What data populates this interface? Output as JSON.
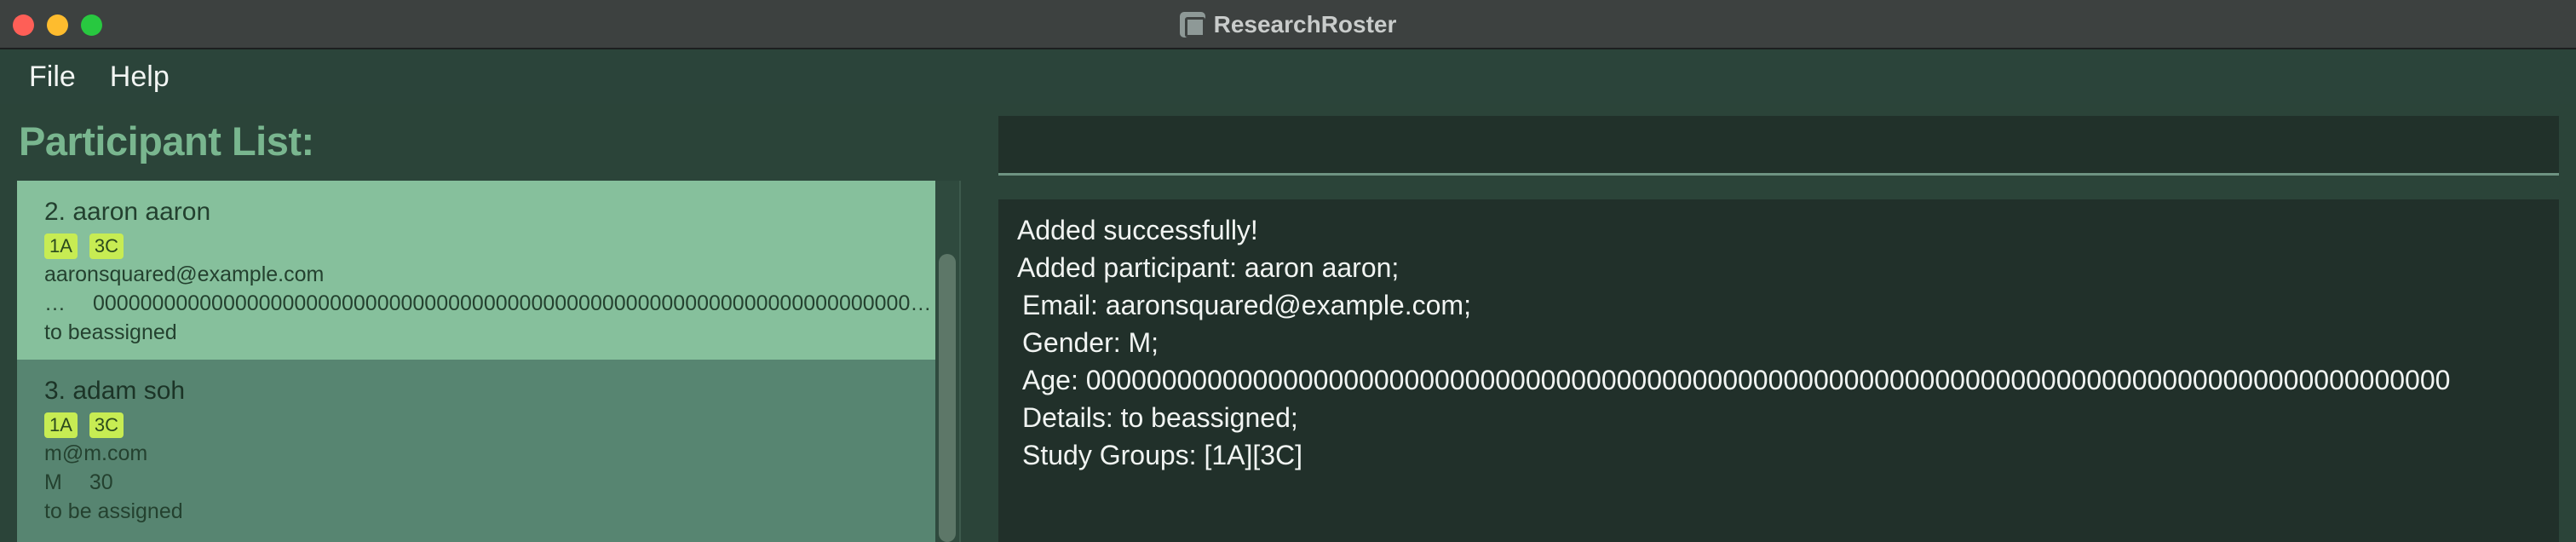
{
  "window": {
    "title": "ResearchRoster"
  },
  "menu": {
    "items": [
      "File",
      "Help"
    ]
  },
  "participant_list": {
    "title": "Participant List:",
    "participants": [
      {
        "name": "2. aaron aaron",
        "tags": [
          "1A",
          "3C"
        ],
        "email": "aaronsquared@example.com",
        "gender": "…",
        "age": "0000000000000000000000000000000000000000000000000000000000000000000000000000…",
        "details": "to beassigned",
        "selected": true
      },
      {
        "name": "3. adam soh",
        "tags": [
          "1A",
          "3C"
        ],
        "email": "m@m.com",
        "gender": "M",
        "age": "30",
        "details": "to be assigned",
        "selected": false
      }
    ]
  },
  "command_box": {
    "value": ""
  },
  "result_display": {
    "lines": [
      "Added successfully!",
      "Added participant: aaron aaron;",
      " Email: aaronsquared@example.com;",
      " Gender: M;",
      " Age: 000000000000000000000000000000000000000000000000000000000000000000000000000000000000000000",
      " Details: to beassigned;",
      " Study Groups: [1A][3C]"
    ]
  },
  "colors": {
    "background": "#2b4439",
    "title_accent": "#79b68f",
    "selected_card": "#86c09c",
    "card": "#578571",
    "tag": "#c7ec53"
  }
}
